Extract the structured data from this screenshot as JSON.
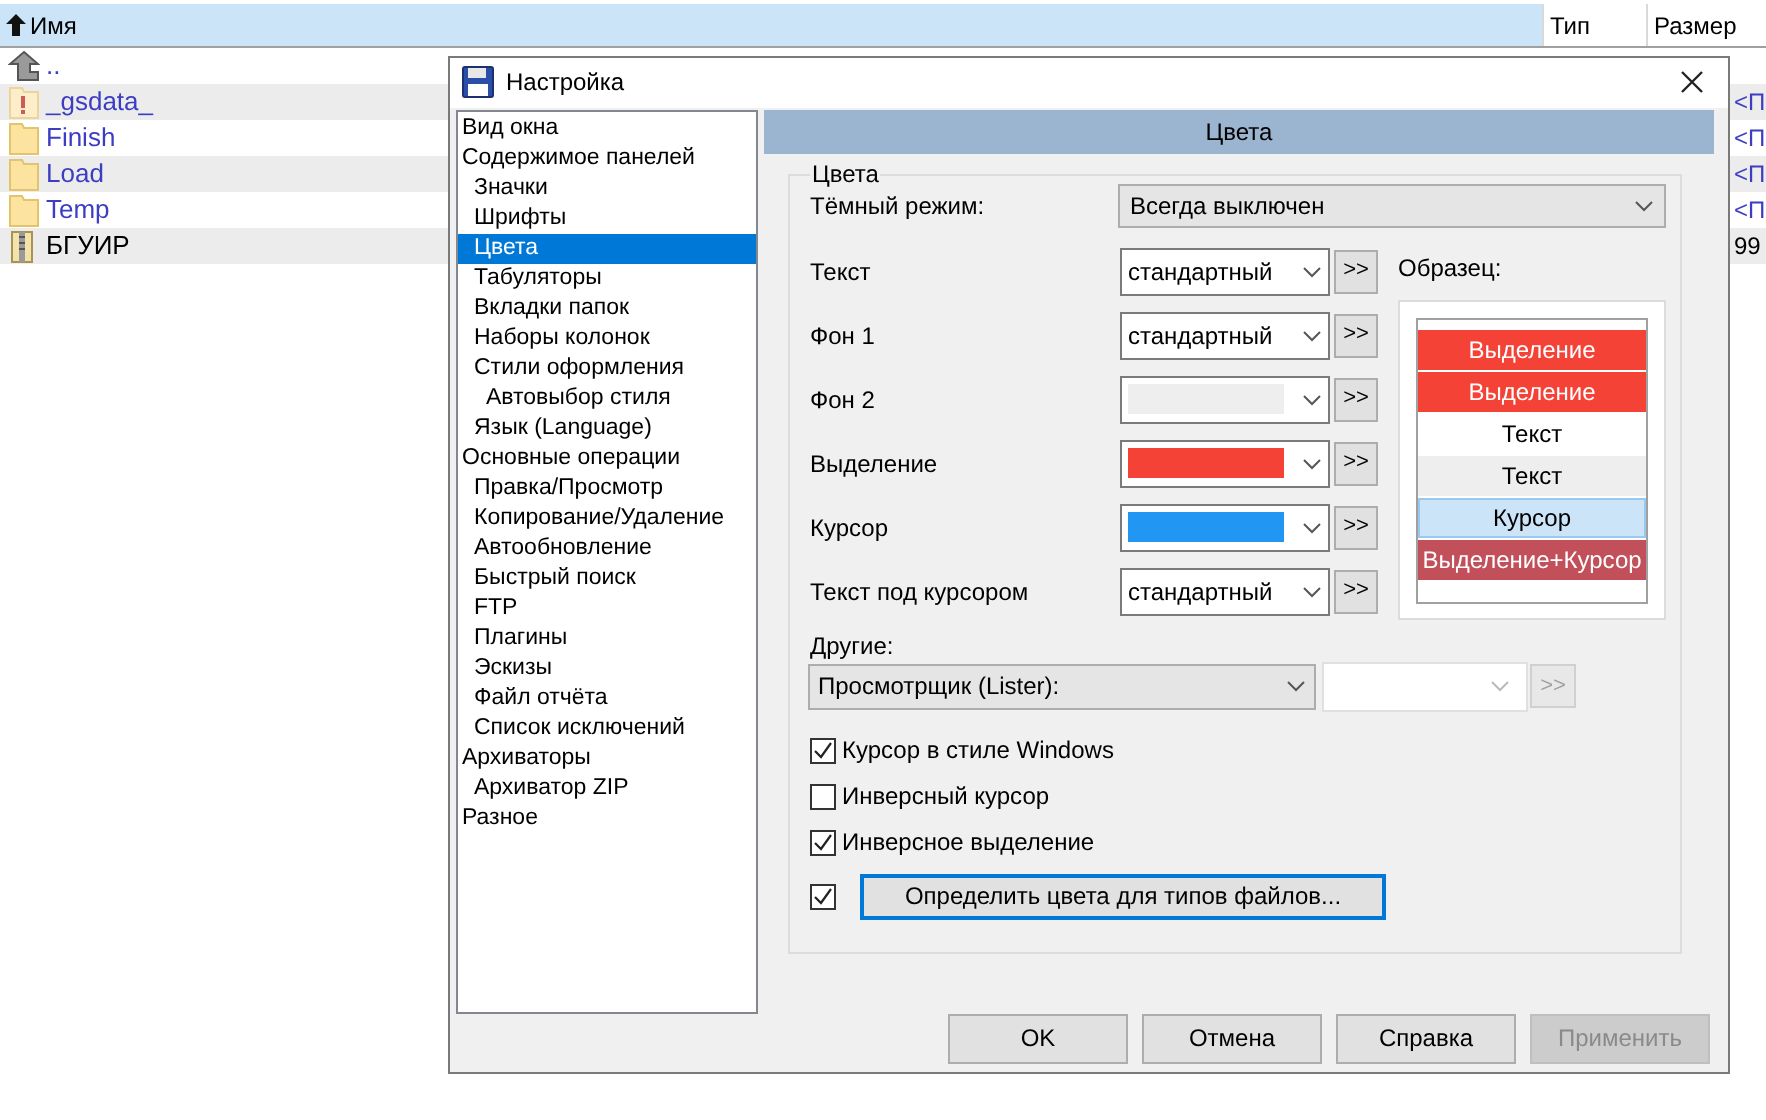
{
  "file_panel": {
    "columns": [
      {
        "label": "Имя",
        "sorted": true
      },
      {
        "label": "Тип",
        "sorted": false
      },
      {
        "label": "Размер",
        "sorted": false
      }
    ],
    "rows": [
      {
        "name": "..",
        "kind": "up"
      },
      {
        "name": "_gsdata_",
        "kind": "hidden_folder",
        "size": "<П"
      },
      {
        "name": "Finish",
        "kind": "folder",
        "size": "<П"
      },
      {
        "name": "Load",
        "kind": "folder",
        "size": "<П"
      },
      {
        "name": "Temp",
        "kind": "folder",
        "size": "<П"
      },
      {
        "name": "БГУИР",
        "kind": "archive",
        "size": "99"
      }
    ]
  },
  "dialog": {
    "title": "Настройка",
    "tree": [
      {
        "label": "Вид окна",
        "selected": false
      },
      {
        "label": "Содержимое панелей",
        "selected": false,
        "children": [
          {
            "label": "Значки",
            "selected": false
          },
          {
            "label": "Шрифты",
            "selected": false
          },
          {
            "label": "Цвета",
            "selected": true
          },
          {
            "label": "Табуляторы",
            "selected": false
          },
          {
            "label": "Вкладки папок",
            "selected": false
          },
          {
            "label": "Наборы колонок",
            "selected": false
          },
          {
            "label": "Стили оформления",
            "selected": false,
            "children": [
              {
                "label": "Автовыбор стиля",
                "selected": false
              }
            ]
          },
          {
            "label": "Язык (Language)",
            "selected": false
          }
        ]
      },
      {
        "label": "Основные операции",
        "selected": false,
        "children": [
          {
            "label": "Правка/Просмотр",
            "selected": false
          },
          {
            "label": "Копирование/Удаление",
            "selected": false
          },
          {
            "label": "Автообновление",
            "selected": false
          },
          {
            "label": "Быстрый поиск",
            "selected": false
          },
          {
            "label": "FTP",
            "selected": false
          },
          {
            "label": "Плагины",
            "selected": false
          },
          {
            "label": "Эскизы",
            "selected": false
          },
          {
            "label": "Файл отчёта",
            "selected": false
          },
          {
            "label": "Список исключений",
            "selected": false
          }
        ]
      },
      {
        "label": "Архиваторы",
        "selected": false,
        "children": [
          {
            "label": "Архиватор ZIP",
            "selected": false
          }
        ]
      },
      {
        "label": "Разное",
        "selected": false
      }
    ],
    "page_title": "Цвета",
    "group_title": "Цвета",
    "dark_mode": {
      "label": "Тёмный режим:",
      "value": "Всегда выключен"
    },
    "color_rows": [
      {
        "label": "Текст",
        "kind": "text",
        "value": "стандартный"
      },
      {
        "label": "Фон 1",
        "kind": "text",
        "value": "стандартный"
      },
      {
        "label": "Фон 2",
        "kind": "swatch",
        "color": "#eeeeee"
      },
      {
        "label": "Выделение",
        "kind": "swatch",
        "color": "#f44336"
      },
      {
        "label": "Курсор",
        "kind": "swatch",
        "color": "#2196f3"
      },
      {
        "label": "Текст под курсором",
        "kind": "text",
        "value": "стандартный"
      }
    ],
    "more_button": ">>",
    "sample_label": "Образец:",
    "sample_rows": [
      {
        "text": "Выделение",
        "kind": "selection"
      },
      {
        "text": "Выделение",
        "kind": "selection"
      },
      {
        "text": "Текст",
        "kind": "background_1"
      },
      {
        "text": "Текст",
        "kind": "background_2"
      },
      {
        "text": "Курсор",
        "kind": "cursor"
      },
      {
        "text": "Выделение+Курсор",
        "kind": "selection_cursor"
      }
    ],
    "other_label": "Другие:",
    "other_value": "Просмотрщик (Lister):",
    "other_more_disabled": true,
    "checkboxes": [
      {
        "label": "Курсор в стиле Windows",
        "checked": true
      },
      {
        "label": "Инверсный курсор",
        "checked": false
      },
      {
        "label": "Инверсное выделение",
        "checked": true
      }
    ],
    "file_types": {
      "checked": true,
      "button": "Определить цвета для типов файлов..."
    },
    "buttons": [
      {
        "label": "OK",
        "disabled": false
      },
      {
        "label": "Отмена",
        "disabled": false
      },
      {
        "label": "Справка",
        "disabled": false
      },
      {
        "label": "Применить",
        "disabled": true
      }
    ]
  }
}
